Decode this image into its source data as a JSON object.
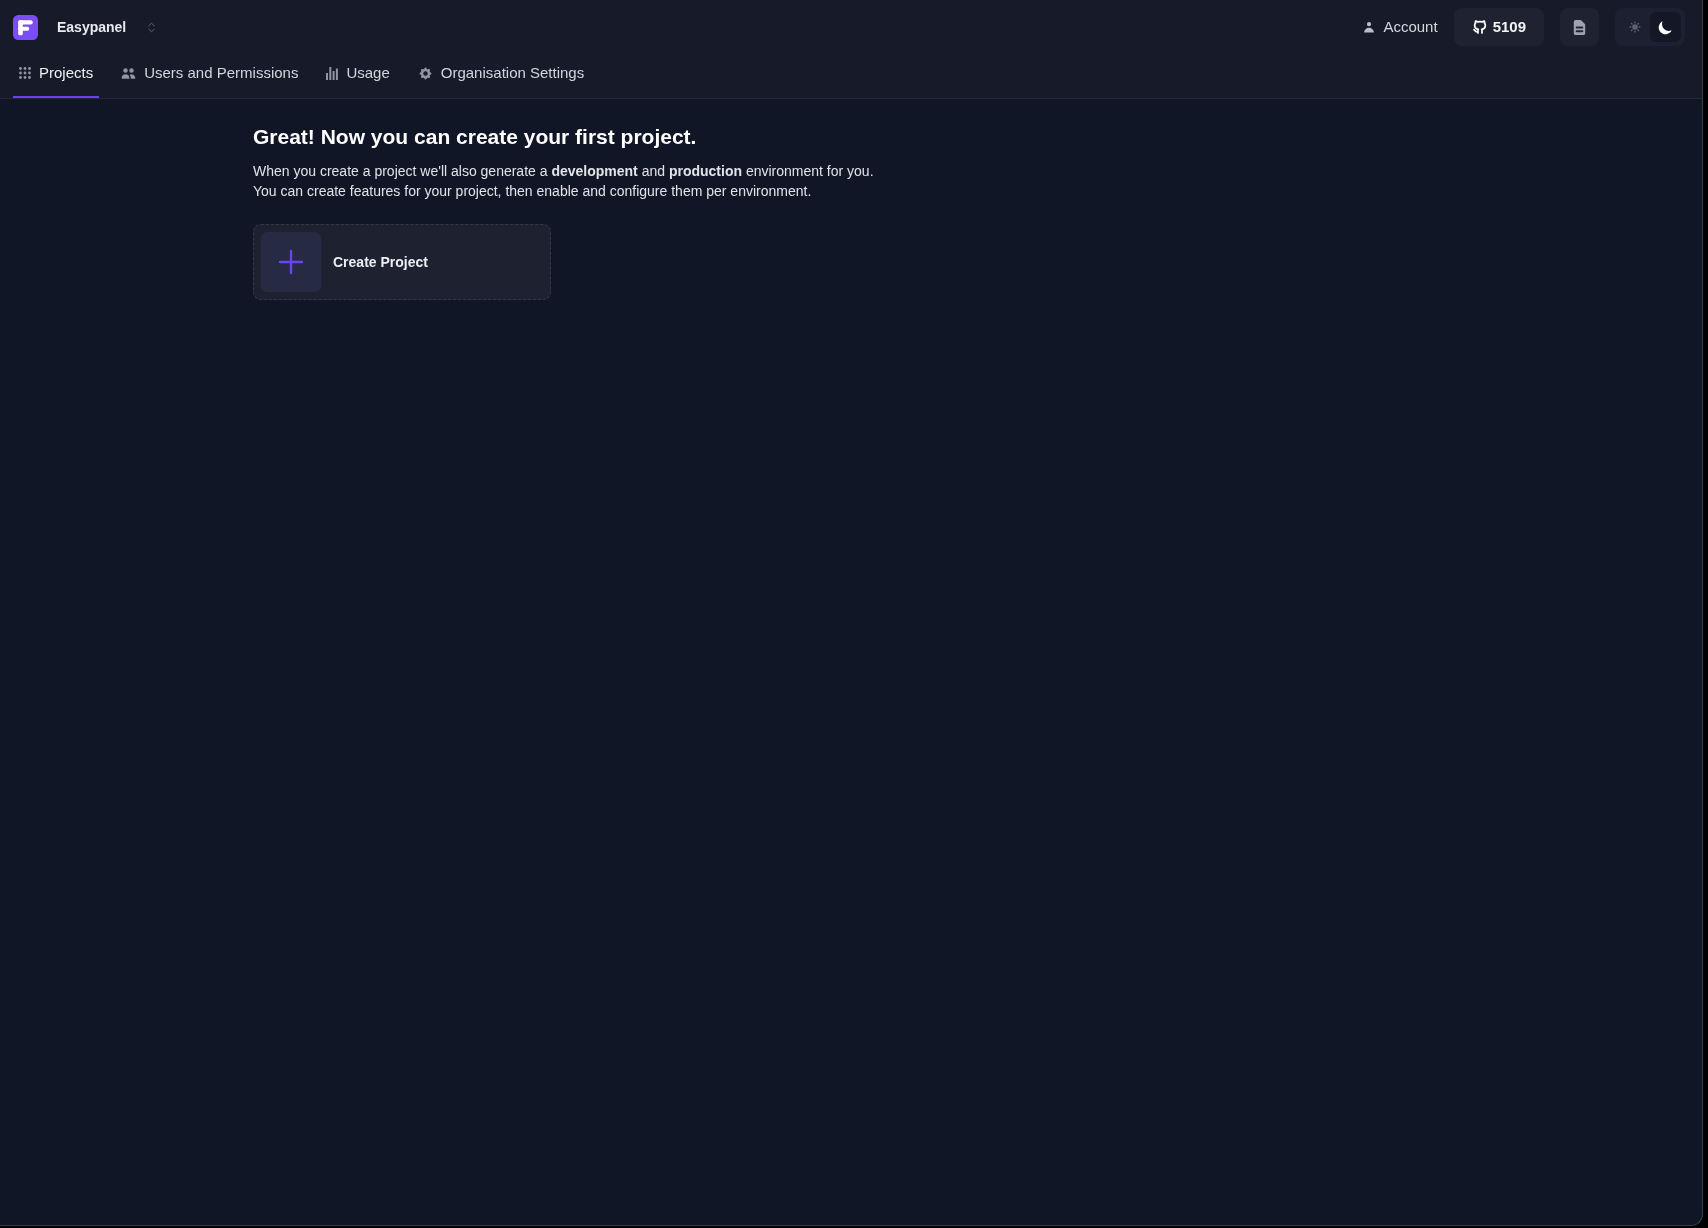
{
  "header": {
    "brand": "Easypanel",
    "account": "Account",
    "github_stars": "5109",
    "theme_toggle": {
      "options": [
        {
          "selected": false
        },
        {
          "selected": true
        }
      ]
    }
  },
  "tabs": [
    {
      "label": "Projects",
      "selected": true
    },
    {
      "label": "Users and Permissions",
      "selected": false
    },
    {
      "label": "Usage",
      "selected": false
    },
    {
      "label": "Organisation Settings",
      "selected": false
    }
  ],
  "intro": {
    "title": "Great! Now you can create your first project.",
    "lines": [
      "When you create a project we'll also generate a **development** and **production** environment for you.",
      "You can create features for your project, then enable and configure them per environment."
    ]
  },
  "create_card": {
    "label": "Create Project"
  }
}
